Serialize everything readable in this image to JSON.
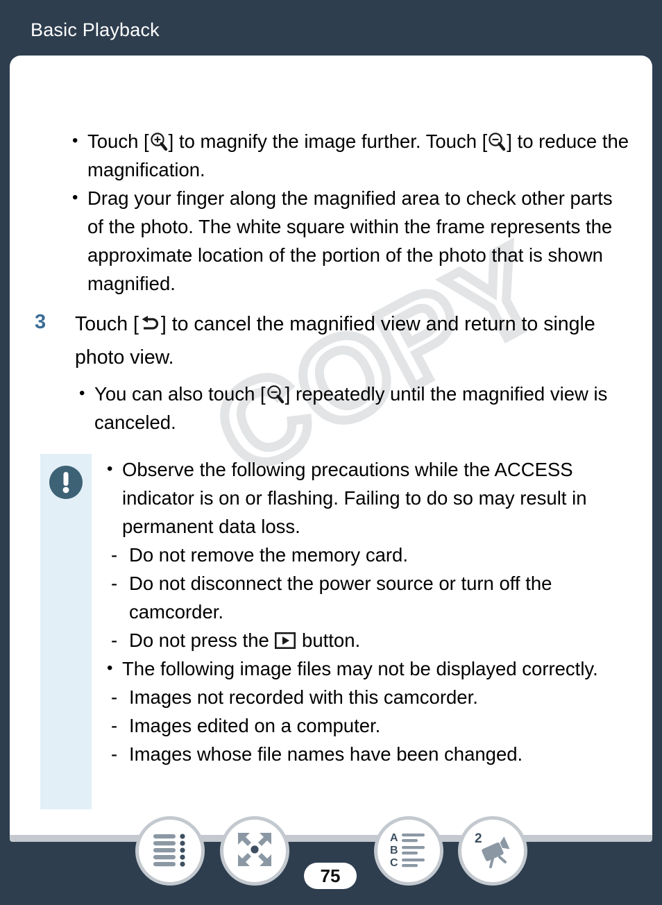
{
  "header": {
    "title": "Basic Playback"
  },
  "colors": {
    "page_background": "#2e3e4f",
    "card_background": "#ffffff",
    "step_number": "#3a6d96",
    "note_strip": "#e3eff7",
    "warning_icon": "#3d6275",
    "nav_icon": "#8b98a4",
    "nav_ring": "#c3c9cf",
    "watermark": "#e2e4e6"
  },
  "watermark": {
    "text": "COPY"
  },
  "top_bullets": [
    {
      "part1": "Touch [",
      "icon1": "magnify-plus-icon",
      "part2": "] to magnify the image further. Touch [",
      "icon2": "magnify-minus-icon",
      "part3": "] to reduce the magnification."
    },
    {
      "text": "Drag your finger along the magnified area to check other parts of the photo. The white square within the frame represents the approximate location of the portion of the photo that is shown magnified."
    }
  ],
  "step": {
    "number": "3",
    "part1": "Touch [",
    "icon": "return-arrow-icon",
    "part2": "] to cancel the magnified view and return to single photo view."
  },
  "sub_bullets": [
    {
      "part1": "You can also touch [",
      "icon": "magnify-minus-icon",
      "part2": "] repeatedly until the magnified view is canceled."
    }
  ],
  "note": {
    "icon": "warning-exclamation-icon",
    "items": [
      {
        "bullet": "Observe the following precautions while the ACCESS indicator is on or flashing. Failing to do so may result in permanent data loss.",
        "dashes": [
          {
            "text": "Do not remove the memory card."
          },
          {
            "text": "Do not disconnect the power source or turn off the camcorder."
          },
          {
            "part1": "Do not press the ",
            "icon": "play-button-icon",
            "part2": " button."
          }
        ]
      },
      {
        "bullet": "The following image files may not be displayed correctly.",
        "dashes": [
          {
            "text": "Images not recorded with this camcorder."
          },
          {
            "text": "Images edited on a computer."
          },
          {
            "text": "Images whose file names have been changed."
          }
        ]
      }
    ]
  },
  "bottom_nav": {
    "page_number": "75",
    "buttons": [
      {
        "name": "table-of-contents-button",
        "icon": "list-lines-icon"
      },
      {
        "name": "full-screen-button",
        "icon": "expand-arrows-icon"
      },
      {
        "name": "alphabetical-index-button",
        "icon": "abc-index-icon"
      },
      {
        "name": "camcorder-manual-button",
        "icon": "camcorder-icon",
        "badge": "2"
      }
    ]
  }
}
